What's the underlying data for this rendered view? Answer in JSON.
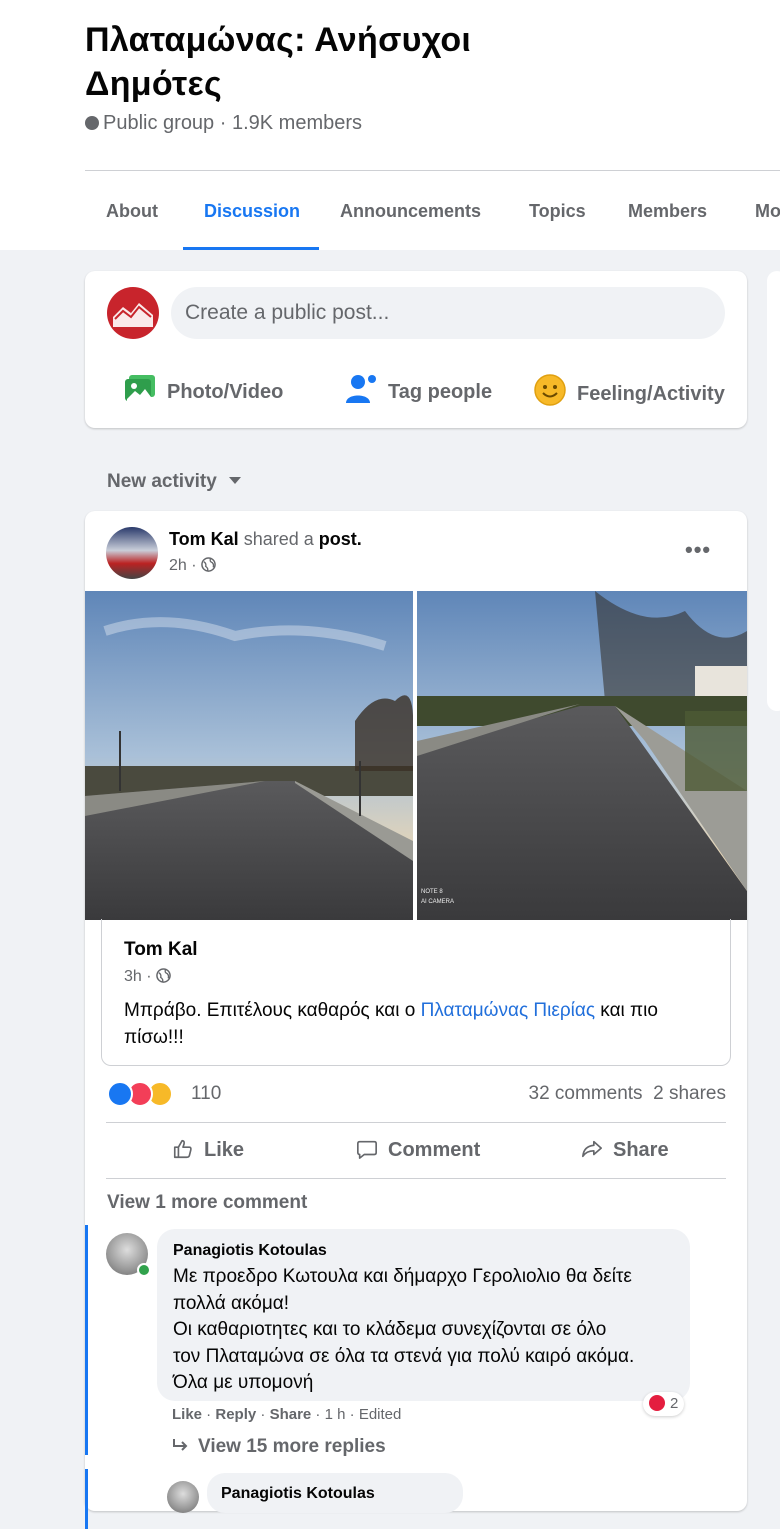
{
  "group": {
    "title": "Πλαταμώνας: Ανήσυχοι Δημότες",
    "meta": "Public group · 1.9K members"
  },
  "tabs": [
    {
      "label": "About",
      "active": false
    },
    {
      "label": "Discussion",
      "active": true
    },
    {
      "label": "Announcements",
      "active": false
    },
    {
      "label": "Topics",
      "active": false
    },
    {
      "label": "Members",
      "active": false
    },
    {
      "label": "Mo",
      "active": false
    }
  ],
  "composer": {
    "placeholder": "Create a public post...",
    "actions": [
      {
        "label": "Photo/Video",
        "icon": "photo-video-icon",
        "color": "#45bd62"
      },
      {
        "label": "Tag people",
        "icon": "tag-people-icon",
        "color": "#1877f2"
      },
      {
        "label": "Feeling/Activity",
        "icon": "feeling-icon",
        "color": "#f7b928"
      }
    ]
  },
  "feed": {
    "sort_label": "New activity"
  },
  "post": {
    "author": "Tom Kal",
    "action_text": "shared a",
    "action_object": "post.",
    "time": "2h ·",
    "more": "•••",
    "shared": {
      "author": "Tom Kal",
      "time": "3h ·",
      "text_before": "Μπράβο. Επιτέλους καθαρός και ο ",
      "link": "Πλαταμώνας Πιερίας",
      "text_after": "  και πιο πίσω!!!"
    },
    "photo_watermark": "NOTE 8\nAI CAMERA",
    "reaction_count": "110",
    "comments_count": "32 comments",
    "shares_count": "2 shares",
    "actions": {
      "like": "Like",
      "comment": "Comment",
      "share": "Share"
    },
    "view_more_comments": "View 1 more comment",
    "comment": {
      "author": "Panagiotis Kotoulas",
      "text_lines": [
        "Με προεδρο Κωτουλα και δήμαρχο Γερολιολιο θα δείτε",
        "πολλά ακόμα!",
        "Οι καθαριοτητες και το κλάδεμα συνεχίζονται σε όλο",
        "τον Πλαταμώνα σε όλα τα στενά για πολύ καιρό ακόμα.",
        "Όλα με υπομονή"
      ],
      "reaction_count": "2",
      "like": "Like",
      "reply": "Reply",
      "share": "Share",
      "time": "1 h",
      "edited": "Edited",
      "view_replies": "View 15 more replies"
    },
    "reply_author": "Panagiotis Kotoulas"
  },
  "colors": {
    "accent": "#1877f2",
    "secondary_text": "#65676b",
    "background": "#f0f2f5"
  }
}
